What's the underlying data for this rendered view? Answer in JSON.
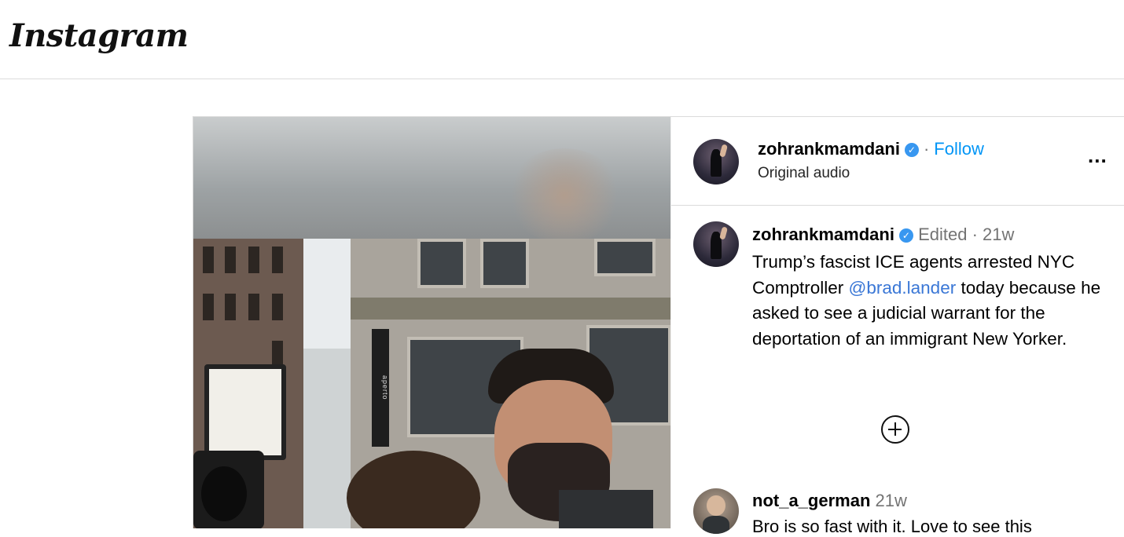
{
  "app": {
    "logo_text": "Instagram"
  },
  "post": {
    "header": {
      "username": "zohrankmamdani",
      "separator": "·",
      "follow_label": "Follow",
      "audio_label": "Original audio",
      "more_label": "..."
    },
    "caption": {
      "username": "zohrankmamdani",
      "edited_label": "Edited",
      "separator": "·",
      "time": "21w",
      "text_before_mention": "Trump’s fascist ICE agents arrested NYC Comptroller ",
      "mention": "@brad.lander",
      "text_after_mention": " today because he asked to see a judicial warrant for the deportation of an immigrant New Yorker."
    },
    "load_more_icon": "plus-circle-icon",
    "comments": [
      {
        "username": "not_a_german",
        "time": "21w",
        "text": "Bro is so fast with it. Love to see this"
      }
    ],
    "media": {
      "sign_text": "aperto"
    }
  },
  "colors": {
    "accent": "#0095f6",
    "mention": "#3a77d6",
    "verified": "#3897f0",
    "muted": "#737373",
    "divider": "#dbdbdb"
  }
}
